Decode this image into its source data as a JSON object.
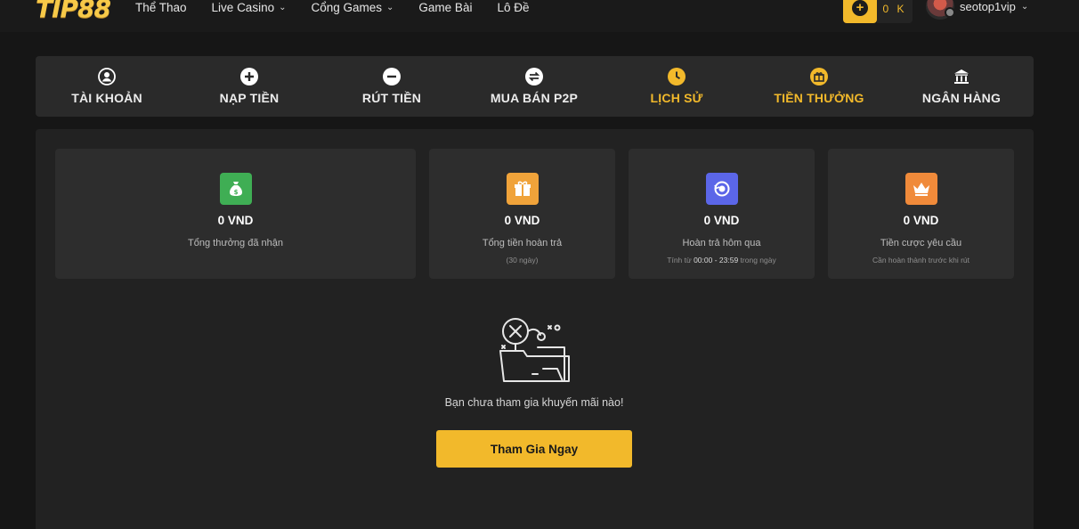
{
  "header": {
    "logo": "TIP88",
    "nav": [
      {
        "label": "Thể Thao",
        "dropdown": false
      },
      {
        "label": "Live Casino",
        "dropdown": true
      },
      {
        "label": "Cổng Games",
        "dropdown": true
      },
      {
        "label": "Game Bài",
        "dropdown": false
      },
      {
        "label": "Lô Đề",
        "dropdown": false
      }
    ],
    "deposit_icon": "plus-icon",
    "balance": "0 K",
    "username": "seotop1vip"
  },
  "tabs": [
    {
      "label": "TÀI KHOẢN",
      "icon": "user-icon",
      "active": false
    },
    {
      "label": "NẠP TIỀN",
      "icon": "plus-circle-icon",
      "active": false
    },
    {
      "label": "RÚT TIỀN",
      "icon": "minus-circle-icon",
      "active": false
    },
    {
      "label": "MUA BÁN P2P",
      "icon": "exchange-icon",
      "active": false
    },
    {
      "label": "LỊCH SỬ",
      "icon": "clock-icon",
      "active": true
    },
    {
      "label": "TIỀN THƯỞNG",
      "icon": "gift-icon",
      "active": true
    },
    {
      "label": "NGÂN HÀNG",
      "icon": "bank-icon",
      "active": false
    }
  ],
  "cards": [
    {
      "amount": "0 VND",
      "desc": "Tổng thưởng đã nhận",
      "icon": "money-bag-icon",
      "color": "#3fae54"
    },
    {
      "amount": "0 VND",
      "desc": "Tổng tiền hoàn trả",
      "sub": "(30 ngày)",
      "icon": "gift-box-icon",
      "color": "#f0a33a"
    },
    {
      "amount": "0 VND",
      "desc": "Hoàn trả hôm qua",
      "sub_pre": "Tính từ ",
      "sub_time": "00:00 - 23:59",
      "sub_post": " trong ngày",
      "icon": "refund-icon",
      "color": "#5b66e8"
    },
    {
      "amount": "0 VND",
      "desc": "Tiền cược yêu cầu",
      "sub": "Cần hoàn thành trước khi rút",
      "icon": "crown-icon",
      "color": "#f08a3a"
    }
  ],
  "empty_state": {
    "message": "Bạn chưa tham gia khuyến mãi nào!",
    "button": "Tham Gia Ngay",
    "icon": "empty-folder-icon"
  },
  "colors": {
    "accent": "#f2b92b",
    "background": "#161616",
    "panel": "#222222",
    "card": "#2d2d2d"
  }
}
